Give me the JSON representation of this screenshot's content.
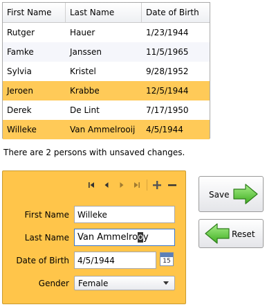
{
  "grid": {
    "columns": [
      "First Name",
      "Last Name",
      "Date of Birth"
    ],
    "rows": [
      {
        "first": "Rutger",
        "last": "Hauer",
        "dob": "1/23/1944",
        "dirty": false
      },
      {
        "first": "Famke",
        "last": "Janssen",
        "dob": "11/5/1965",
        "dirty": false
      },
      {
        "first": "Sylvia",
        "last": "Kristel",
        "dob": "9/28/1952",
        "dirty": false
      },
      {
        "first": "Jeroen",
        "last": "Krabbe",
        "dob": "12/5/1944",
        "dirty": true
      },
      {
        "first": "Derek",
        "last": "De Lint",
        "dob": "7/17/1950",
        "dirty": false
      },
      {
        "first": "Willeke",
        "last": "Van Ammelrooij",
        "dob": "4/5/1944",
        "dirty": true
      }
    ]
  },
  "status_text": "There are 2 persons with unsaved changes.",
  "form": {
    "nav_icons": [
      "first-record-icon",
      "previous-record-icon",
      "next-record-icon",
      "last-record-icon",
      "add-record-icon",
      "delete-record-icon"
    ],
    "first_name_label": "First Name",
    "first_name_value": "Willeke",
    "last_name_label": "Last Name",
    "last_name_value_pre": "Van Ammelro",
    "last_name_value_sel": "o",
    "last_name_value_post": "y",
    "dob_label": "Date of Birth",
    "dob_value": "4/5/1944",
    "calendar_day": "15",
    "gender_label": "Gender",
    "gender_value": "Female"
  },
  "buttons": {
    "save_label": "Save",
    "reset_label": "Reset"
  },
  "colors": {
    "dirty_row": "#ffca58",
    "form_background": "#ffc54a",
    "arrow_green": "#5cc83a"
  }
}
